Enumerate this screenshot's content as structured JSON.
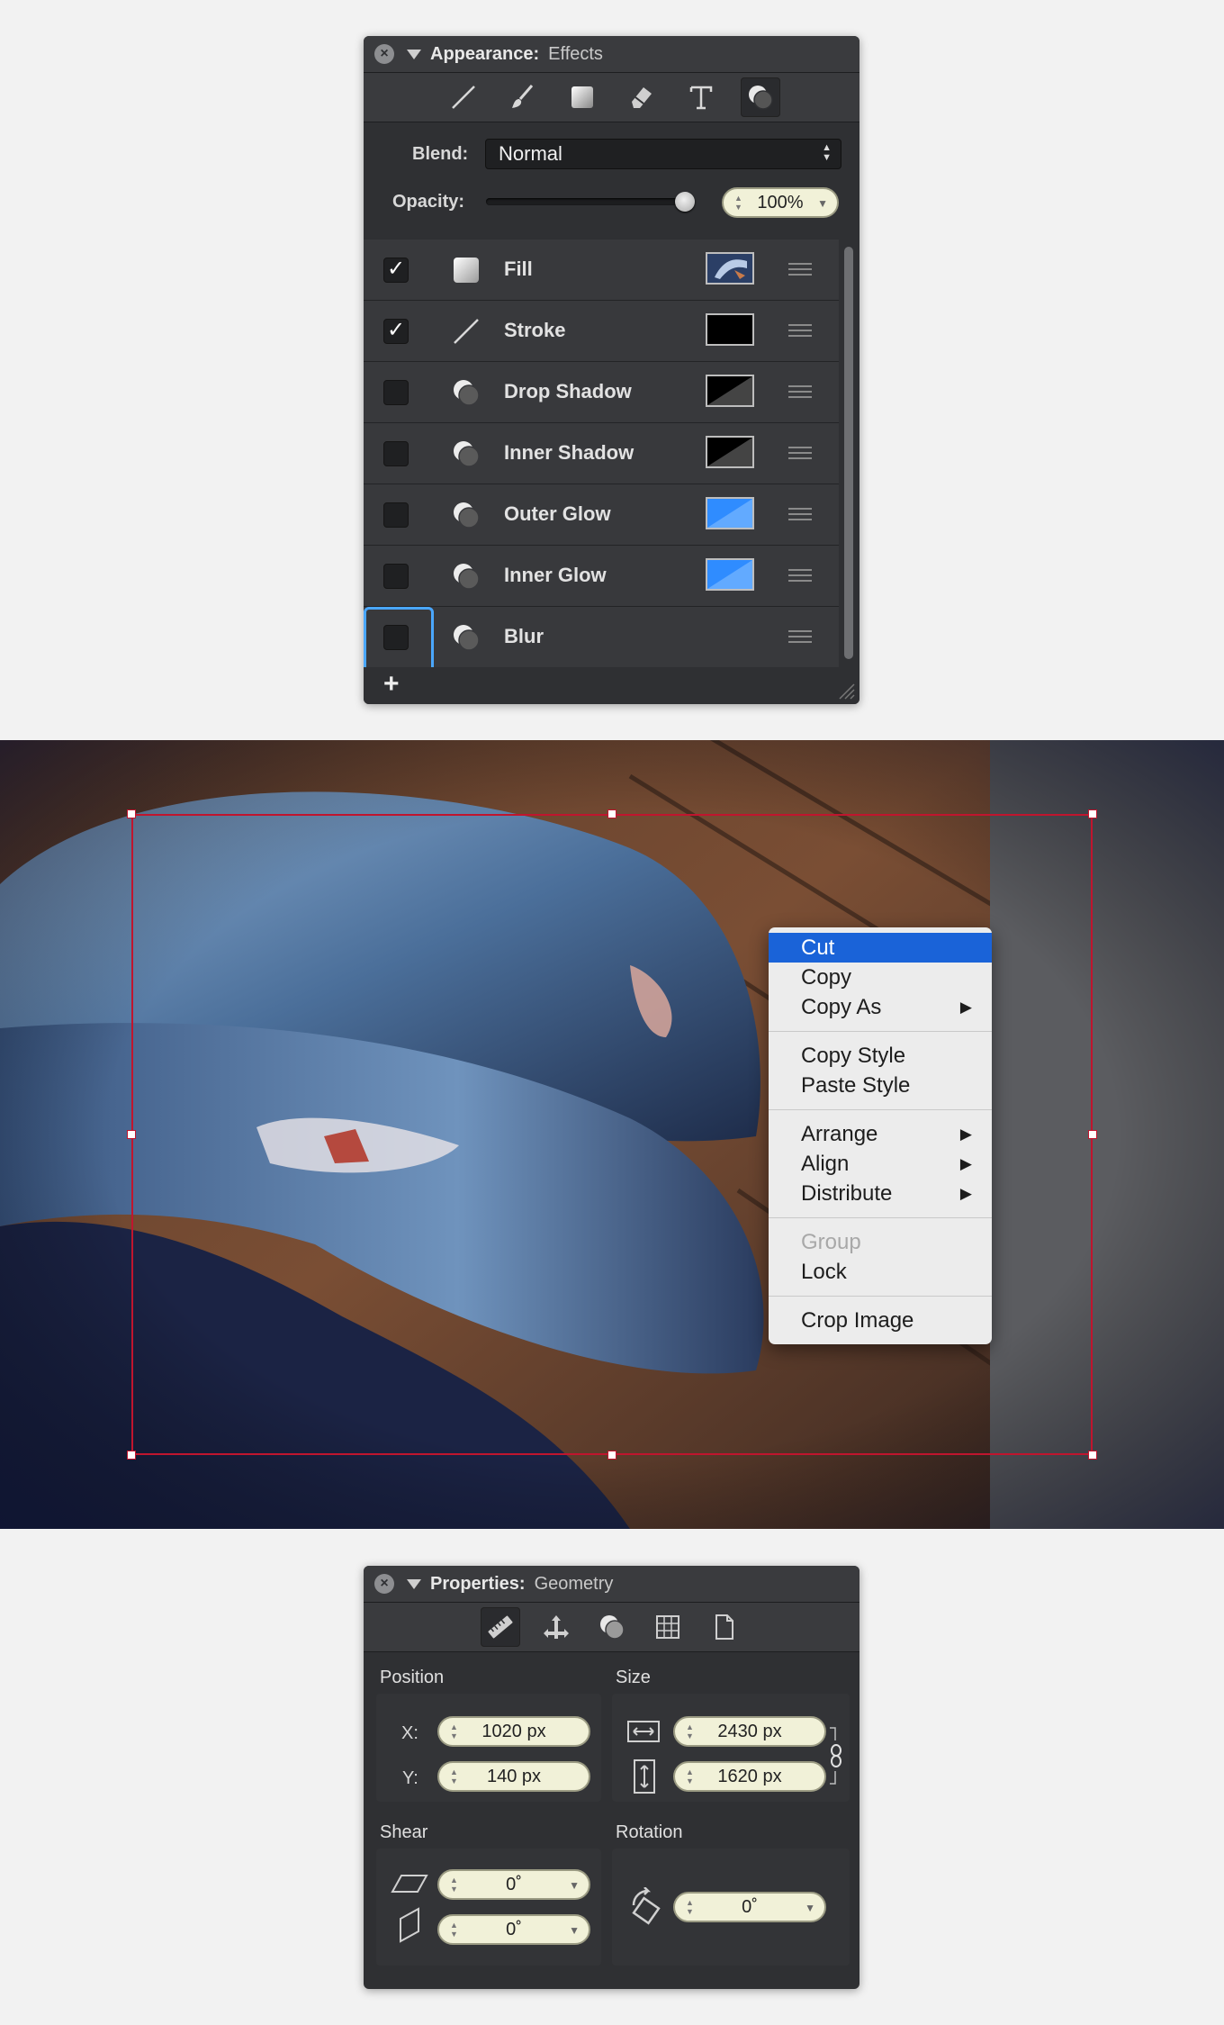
{
  "appearance": {
    "title": "Appearance:",
    "subtitle": "Effects",
    "tools": [
      "line-icon",
      "brush-icon",
      "gradient-square-icon",
      "eraser-icon",
      "text-icon",
      "effects-icon"
    ],
    "blend_label": "Blend:",
    "blend_value": "Normal",
    "opacity_label": "Opacity:",
    "opacity_value": "100%",
    "opacity_level": 1.0,
    "effects": [
      {
        "name": "Fill",
        "checked": true,
        "icon": "fill-square-icon",
        "swatch": "image"
      },
      {
        "name": "Stroke",
        "checked": true,
        "icon": "stroke-line-icon",
        "swatch": "#000000"
      },
      {
        "name": "Drop Shadow",
        "checked": false,
        "icon": "effect-circles-icon",
        "swatch": "black-diagonal"
      },
      {
        "name": "Inner Shadow",
        "checked": false,
        "icon": "effect-circles-icon",
        "swatch": "black-diagonal"
      },
      {
        "name": "Outer Glow",
        "checked": false,
        "icon": "effect-circles-icon",
        "swatch": "blue-diagonal"
      },
      {
        "name": "Inner Glow",
        "checked": false,
        "icon": "effect-circles-icon",
        "swatch": "blue-diagonal"
      },
      {
        "name": "Blur",
        "checked": false,
        "icon": "effect-circles-icon",
        "swatch": "none"
      }
    ],
    "add_label": "+"
  },
  "colors": {
    "selection": "#c0152e",
    "menu_highlight": "#1a63d8",
    "focus_ring": "#4aa7ff",
    "glow_blue": "#2f8cff"
  },
  "context_menu": {
    "groups": [
      [
        {
          "label": "Cut",
          "highlighted": true
        },
        {
          "label": "Copy"
        },
        {
          "label": "Copy As",
          "submenu": true
        }
      ],
      [
        {
          "label": "Copy Style"
        },
        {
          "label": "Paste Style"
        }
      ],
      [
        {
          "label": "Arrange",
          "submenu": true
        },
        {
          "label": "Align",
          "submenu": true
        },
        {
          "label": "Distribute",
          "submenu": true
        }
      ],
      [
        {
          "label": "Group",
          "disabled": true
        },
        {
          "label": "Lock"
        }
      ],
      [
        {
          "label": "Crop Image"
        }
      ]
    ],
    "submenu_glyph": "▶"
  },
  "properties": {
    "title": "Properties:",
    "subtitle": "Geometry",
    "tools": [
      "ruler-icon",
      "move-arrows-icon",
      "circles-icon",
      "grid-icon",
      "page-icon"
    ],
    "position_label": "Position",
    "size_label": "Size",
    "shear_label": "Shear",
    "rotation_label": "Rotation",
    "x_label": "X:",
    "y_label": "Y:",
    "x_value": "1020 px",
    "y_value": "140 px",
    "width_value": "2430 px",
    "height_value": "1620 px",
    "shear_h_value": "0˚",
    "shear_v_value": "0˚",
    "rotation_value": "0˚"
  }
}
